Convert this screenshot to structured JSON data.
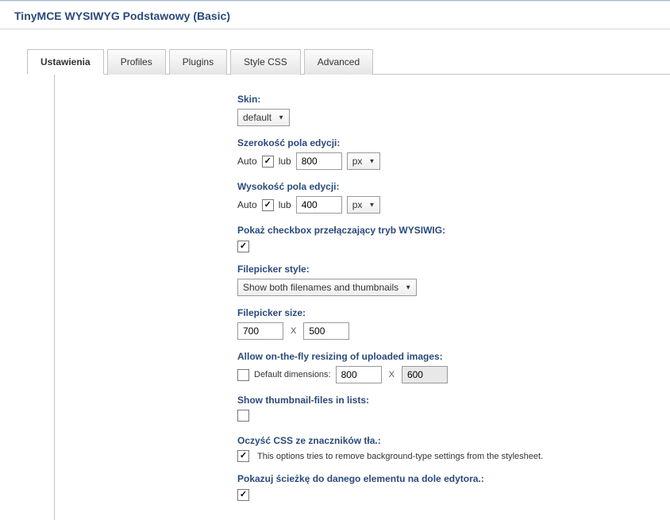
{
  "header": {
    "title": "TinyMCE WYSIWYG Podstawowy (Basic)"
  },
  "tabs": {
    "active": "Ustawienia",
    "items": [
      "Ustawienia",
      "Profiles",
      "Plugins",
      "Style CSS",
      "Advanced"
    ]
  },
  "fields": {
    "skin": {
      "label": "Skin:",
      "value": "default"
    },
    "width": {
      "label": "Szerokość pola edycji:",
      "auto": "Auto",
      "lub": "lub",
      "value": "800",
      "unit": "px"
    },
    "height": {
      "label": "Wysokość pola edycji:",
      "auto": "Auto",
      "lub": "lub",
      "value": "400",
      "unit": "px"
    },
    "switchcb": {
      "label": "Pokaż checkbox przełączający tryb WYSIWIG:"
    },
    "fpstyle": {
      "label": "Filepicker style:",
      "value": "Show both filenames and thumbnails"
    },
    "fpsize": {
      "label": "Filepicker size:",
      "w": "700",
      "x": "X",
      "h": "500"
    },
    "resize": {
      "label": "Allow on-the-fly resizing of uploaded images:",
      "dimlabel": "Default dimensions:",
      "w": "800",
      "x": "X",
      "h": "600"
    },
    "thumb": {
      "label": "Show thumbnail-files in lists:"
    },
    "cleancss": {
      "label": "Oczyść CSS ze znaczników tła.:",
      "desc": "This options tries to remove background-type settings from the stylesheet."
    },
    "path": {
      "label": "Pokazuj ścieżkę do danego elementu na dole edytora.:"
    }
  }
}
